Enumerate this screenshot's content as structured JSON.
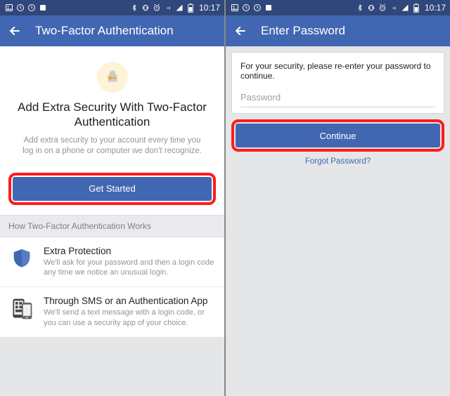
{
  "status": {
    "time": "10:17"
  },
  "left": {
    "title": "Two-Factor Authentication",
    "hero_title": "Add Extra Security With Two-Factor Authentication",
    "hero_sub": "Add extra security to your account every time you log in on a phone or computer we don't recognize.",
    "cta": "Get Started",
    "section_header": "How Two-Factor Authentication Works",
    "items": [
      {
        "title": "Extra Protection",
        "desc": "We'll ask for your password and then a login code any time we notice an unusual login."
      },
      {
        "title": "Through SMS or an Authentication App",
        "desc": "We'll send a text message with a login code, or you can use a security app of your choice."
      }
    ]
  },
  "right": {
    "title": "Enter Password",
    "card_text": "For your security, please re-enter your password to continue.",
    "placeholder": "Password",
    "cta": "Continue",
    "forgot": "Forgot Password?"
  }
}
